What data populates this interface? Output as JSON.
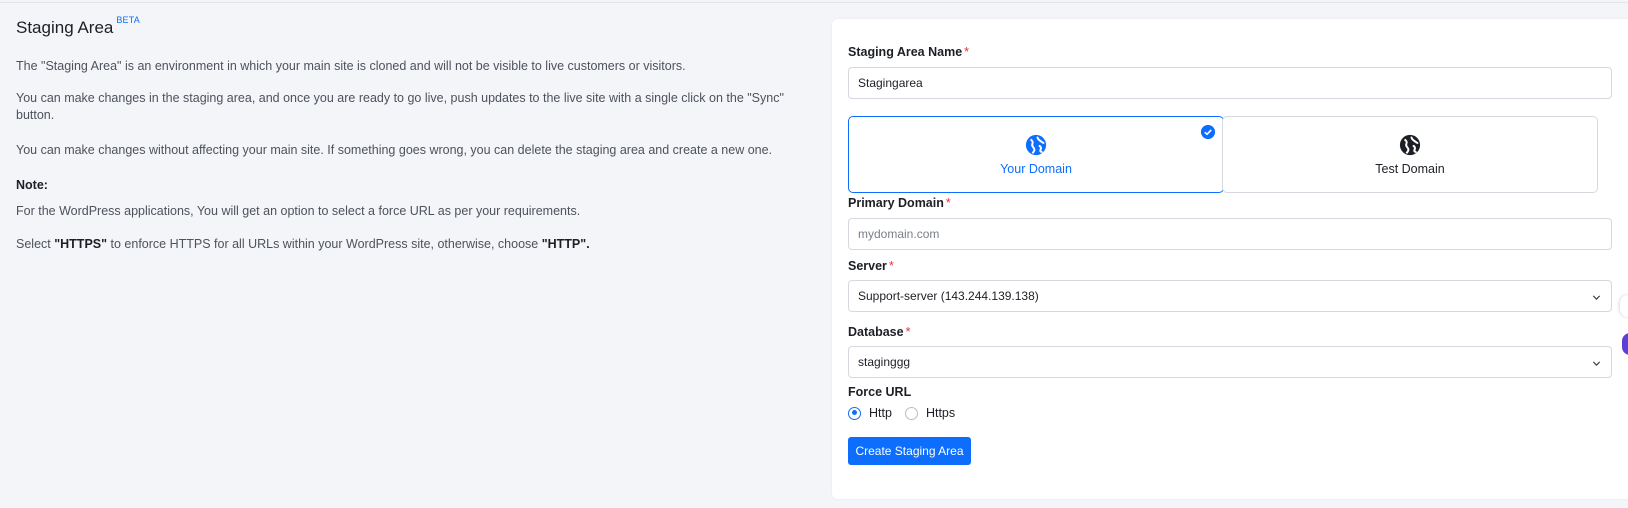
{
  "info": {
    "title": "Staging Area",
    "badge": "BETA",
    "para1": "The \"Staging Area\" is an environment in which your main site is cloned and will not be visible to live customers or visitors.",
    "para2": "You can make changes in the staging area, and once you are ready to go live, push updates to the live site with a single click on the \"Sync\" button.",
    "para3": "You can make changes without affecting your main site. If something goes wrong, you can delete the staging area and create a new one.",
    "note_title": "Note:",
    "para4": "For the WordPress applications, You will get an option to select a force URL as per your requirements.",
    "para5_prefix": "Select ",
    "para5_https": "\"HTTPS\"",
    "para5_middle": " to enforce HTTPS for all URLs within your WordPress site, otherwise, choose ",
    "para5_http": "\"HTTP\"."
  },
  "form": {
    "name_label": "Staging Area Name",
    "required_mark": "*",
    "name_value": "Stagingarea",
    "domain_options": [
      {
        "label": "Your Domain",
        "selected": true,
        "icon": "globe-icon"
      },
      {
        "label": "Test Domain",
        "selected": false,
        "icon": "globe-icon"
      }
    ],
    "primary_domain_label": "Primary Domain",
    "primary_domain_placeholder": "mydomain.com",
    "server_label": "Server",
    "server_value": "Support-server (143.244.139.138)",
    "database_label": "Database",
    "database_value": "staginggg",
    "force_url_label": "Force URL",
    "force_url_options": [
      {
        "label": "Http",
        "selected": true
      },
      {
        "label": "Https",
        "selected": false
      }
    ],
    "submit_label": "Create Staging Area"
  },
  "colors": {
    "accent": "#0d6efd",
    "required": "#dc3545",
    "background": "#f4f5f9"
  }
}
